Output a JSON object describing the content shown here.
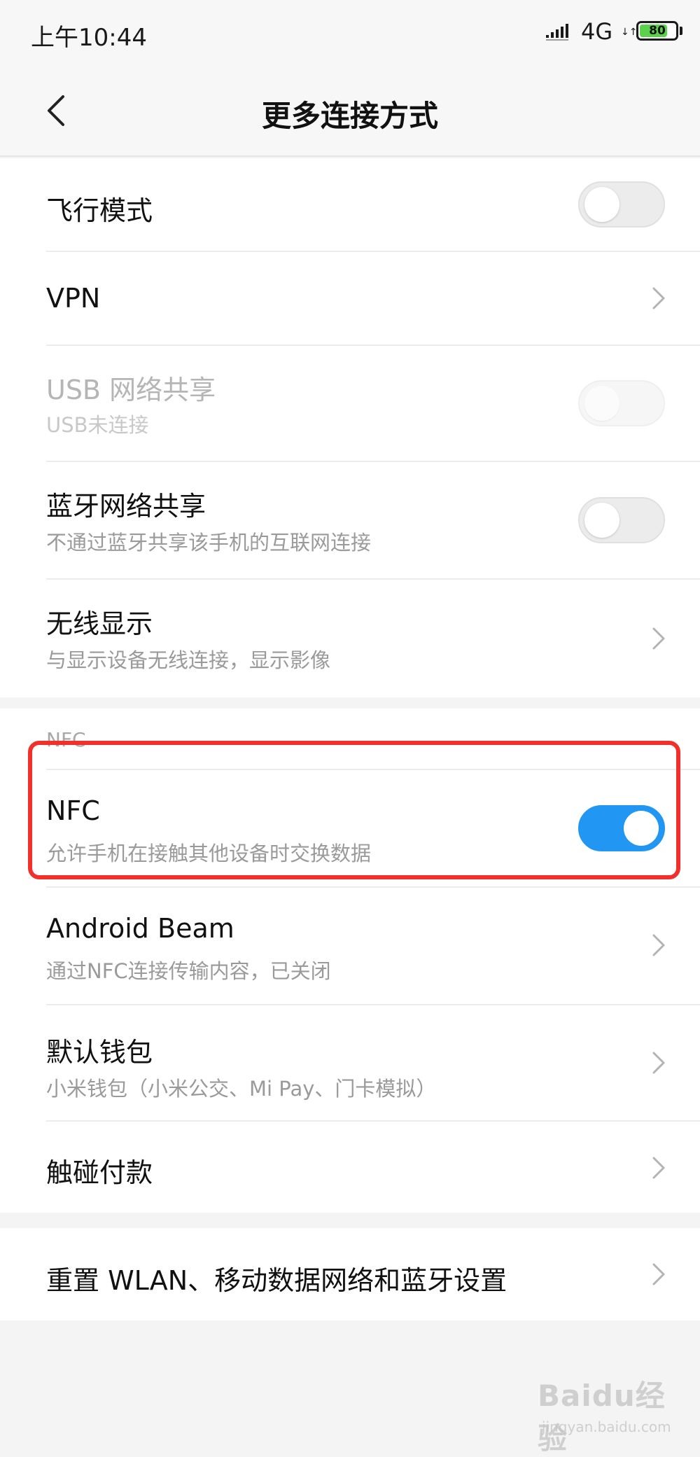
{
  "status_bar": {
    "time": "上午10:44",
    "network": "4G",
    "network_arrows": "↓↑",
    "battery_level": "80",
    "battery_fraction": 0.8,
    "battery_color": "#5ad24c"
  },
  "header": {
    "back_icon": "chevron-left-icon",
    "title": "更多连接方式"
  },
  "settings": {
    "airplane_mode": {
      "title": "飞行模式",
      "enabled": false
    },
    "vpn": {
      "title": "VPN"
    },
    "usb_tethering": {
      "title": "USB 网络共享",
      "subtitle": "USB未连接",
      "enabled": false,
      "disabled": true
    },
    "bluetooth_tethering": {
      "title": "蓝牙网络共享",
      "subtitle": "不通过蓝牙共享该手机的互联网连接",
      "enabled": false
    },
    "wireless_display": {
      "title": "无线显示",
      "subtitle": "与显示设备无线连接，显示影像"
    }
  },
  "nfc_section": {
    "header": "NFC",
    "nfc": {
      "title": "NFC",
      "subtitle": "允许手机在接触其他设备时交换数据",
      "enabled": true
    },
    "android_beam": {
      "title": "Android Beam",
      "subtitle": "通过NFC连接传输内容，已关闭"
    },
    "default_wallet": {
      "title": "默认钱包",
      "subtitle": "小米钱包（小米公交、Mi Pay、门卡模拟）"
    },
    "tap_to_pay": {
      "title": "触碰付款"
    }
  },
  "reset": {
    "title": "重置 WLAN、移动数据网络和蓝牙设置"
  },
  "colors": {
    "accent_toggle_on": "#2196f3",
    "highlight": "#f2302b",
    "background": "#f4f4f4"
  },
  "watermark": {
    "logo": "Baidu经验",
    "url": "jingyan.baidu.com"
  }
}
